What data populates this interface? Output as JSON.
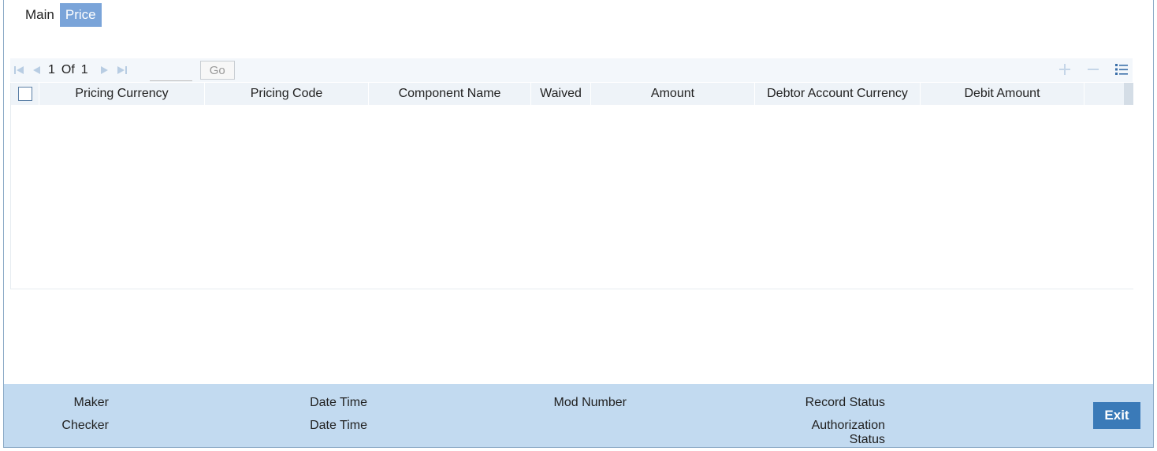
{
  "tabs": [
    {
      "label": "Main",
      "active": false
    },
    {
      "label": "Price",
      "active": true
    }
  ],
  "pager": {
    "current": "1",
    "of_label": "Of",
    "total": "1",
    "go_label": "Go"
  },
  "grid": {
    "columns": [
      "Pricing Currency",
      "Pricing Code",
      "Component Name",
      "Waived",
      "Amount",
      "Debtor Account Currency",
      "Debit Amount"
    ],
    "rows": []
  },
  "footer": {
    "maker": "Maker",
    "checker": "Checker",
    "date_time_1": "Date Time",
    "date_time_2": "Date Time",
    "mod_number": "Mod Number",
    "record_status": "Record Status",
    "authorization_status_line1": "Authorization",
    "authorization_status_line2": "Status",
    "exit_label": "Exit"
  },
  "colors": {
    "active_tab": "#7aa4d9",
    "footer_bg": "#c2daf0",
    "exit_button": "#3a7ab8"
  }
}
